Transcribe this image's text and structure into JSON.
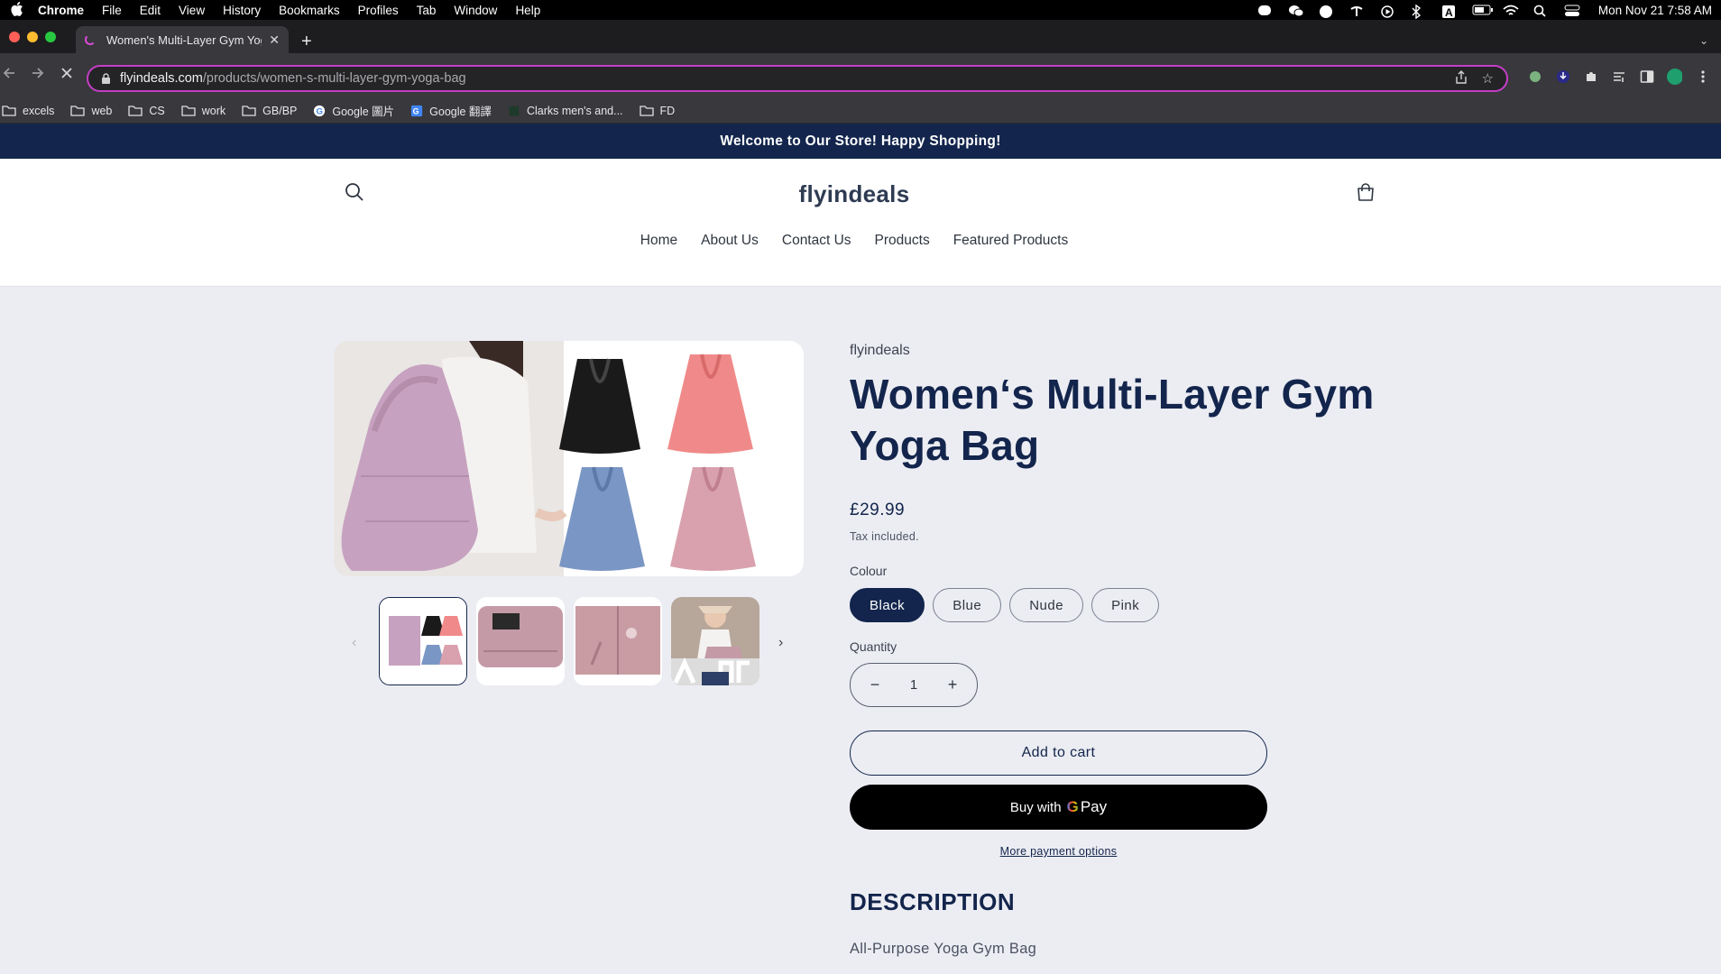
{
  "os_menubar": {
    "app_name": "Chrome",
    "menus": [
      "File",
      "Edit",
      "View",
      "History",
      "Bookmarks",
      "Profiles",
      "Tab",
      "Window",
      "Help"
    ],
    "status_icons": [
      "line-icon",
      "wechat-icon",
      "figure-icon",
      "palm-icon",
      "play-icon",
      "bluetooth-icon",
      "keyboard-a-icon",
      "battery-icon",
      "wifi-icon",
      "spotlight-icon",
      "control-center-icon"
    ],
    "clock": "Mon Nov 21  7:58 AM"
  },
  "browser": {
    "tab_title": "Women's Multi-Layer Gym Yog",
    "url_host": "flyindeals.com",
    "url_path": "/products/women-s-multi-layer-gym-yoga-bag",
    "bookmarks": [
      {
        "label": "excels",
        "icon": "folder-icon"
      },
      {
        "label": "web",
        "icon": "folder-icon"
      },
      {
        "label": "CS",
        "icon": "folder-icon"
      },
      {
        "label": "work",
        "icon": "folder-icon"
      },
      {
        "label": "GB/BP",
        "icon": "folder-icon"
      },
      {
        "label": "Google 圖片",
        "icon": "google-icon"
      },
      {
        "label": "Google 翻譯",
        "icon": "translate-icon"
      },
      {
        "label": "Clarks men's and...",
        "icon": "site-icon"
      },
      {
        "label": "FD",
        "icon": "folder-icon"
      }
    ],
    "accent_color": "#c53ec5"
  },
  "store": {
    "announcement": "Welcome to Our Store! Happy Shopping!",
    "logo": "flyindeals",
    "nav": [
      "Home",
      "About Us",
      "Contact Us",
      "Products",
      "Featured Products"
    ],
    "brand_color": "#13254c"
  },
  "product": {
    "vendor": "flyindeals",
    "title": "Women‘s Multi-Layer Gym Yoga Bag",
    "price": "£29.99",
    "tax_note": "Tax included.",
    "colour_label": "Colour",
    "colours": [
      "Black",
      "Blue",
      "Nude",
      "Pink"
    ],
    "selected_colour": "Black",
    "quantity_label": "Quantity",
    "quantity": "1",
    "add_to_cart": "Add to cart",
    "buy_with": "Buy with",
    "gpay_label": "Pay",
    "more_payment": "More payment options",
    "description_heading": "DESCRIPTION",
    "description_text": "All-Purpose Yoga Gym Bag",
    "thumbnail_count": 4,
    "active_thumbnail": 1
  }
}
